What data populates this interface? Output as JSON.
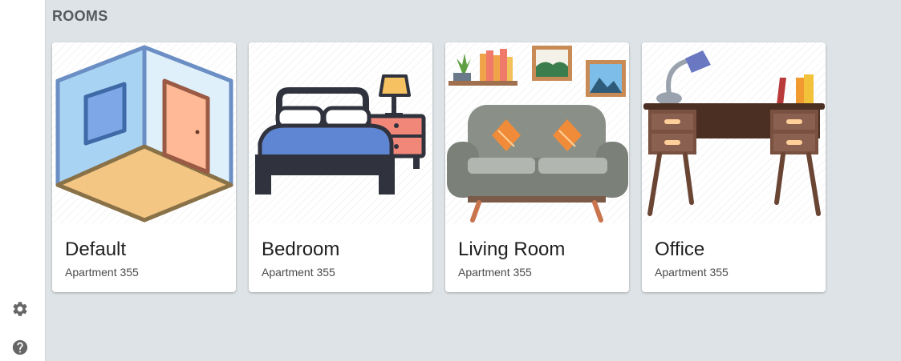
{
  "section": {
    "title": "ROOMS"
  },
  "sidebar": {
    "items": [
      {
        "icon": "gear-icon"
      },
      {
        "icon": "help-icon"
      }
    ]
  },
  "rooms": [
    {
      "name": "Default",
      "subtitle": "Apartment 355",
      "illustration": "empty-room"
    },
    {
      "name": "Bedroom",
      "subtitle": "Apartment 355",
      "illustration": "bed-with-nightstand"
    },
    {
      "name": "Living Room",
      "subtitle": "Apartment 355",
      "illustration": "sofa-with-shelf-and-pictures"
    },
    {
      "name": "Office",
      "subtitle": "Apartment 355",
      "illustration": "desk-with-lamp-and-books"
    }
  ],
  "colors": {
    "background": "#dde3e6",
    "sidebar": "#ffffff",
    "title": "#555a5e",
    "icon": "#666666"
  }
}
